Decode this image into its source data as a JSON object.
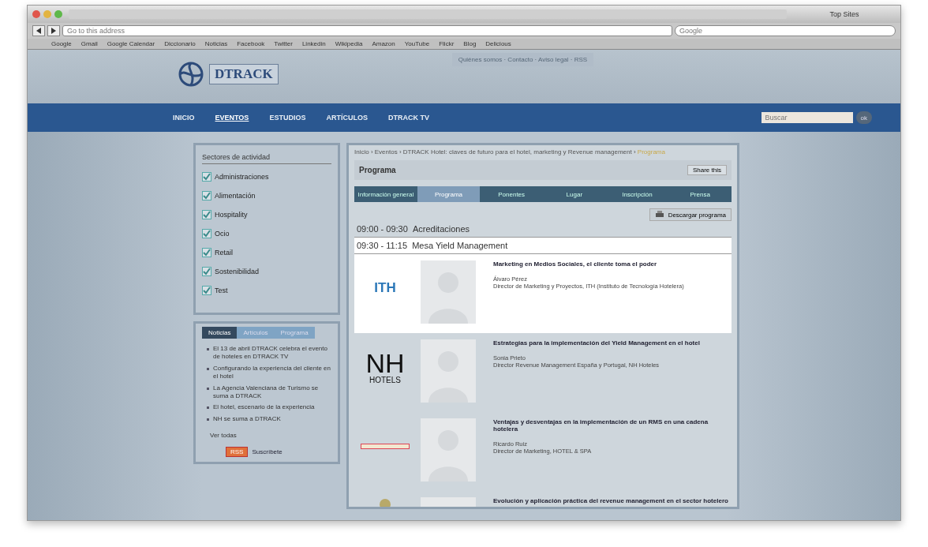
{
  "browser": {
    "tab_title": "Top Sites",
    "address_placeholder": "Go to this address",
    "search_placeholder": "Google",
    "bookmarks": [
      "Google",
      "Gmail",
      "Google Calendar",
      "Diccionario",
      "Noticias",
      "Facebook",
      "Twitter",
      "Linkedin",
      "Wikipedia",
      "Amazon",
      "YouTube",
      "Flickr",
      "Blog",
      "Delicious"
    ]
  },
  "site": {
    "logo": "DTRACK",
    "top_links": "Quiénes somos · Contacto · Aviso legal · RSS",
    "nav": [
      {
        "label": "INICIO",
        "selected": false
      },
      {
        "label": "EVENTOS",
        "selected": true
      },
      {
        "label": "ESTUDIOS",
        "selected": false
      },
      {
        "label": "ARTÍCULOS",
        "selected": false
      },
      {
        "label": "DTRACK TV",
        "selected": false
      }
    ],
    "search_placeholder": "Buscar",
    "search_button": "ok"
  },
  "sidebar": {
    "title": "Sectores de actividad",
    "sectors": [
      {
        "label": "Administraciones",
        "checked": true
      },
      {
        "label": "Alimentación",
        "checked": true
      },
      {
        "label": "Hospitality",
        "checked": true
      },
      {
        "label": "Ocio",
        "checked": true
      },
      {
        "label": "Retail",
        "checked": true
      },
      {
        "label": "Sostenibilidad",
        "checked": true
      },
      {
        "label": "Test",
        "checked": true
      }
    ],
    "tabs": [
      {
        "label": "Noticias",
        "selected": true
      },
      {
        "label": "Artículos",
        "selected": false
      },
      {
        "label": "Programa",
        "selected": false
      }
    ],
    "news": [
      "El 13 de abril DTRACK celebra el evento de hoteles en DTRACK TV",
      "Configurando la experiencia del cliente en el hotel",
      "La Agencia Valenciana de Turismo se suma a DTRACK",
      "El hotel, escenario de la experiencia",
      "NH se suma a DTRACK"
    ],
    "more": "Ver todas",
    "rss": "RSS",
    "subscribe": "Suscríbete"
  },
  "main": {
    "breadcrumb": "Inicio › Eventos › DTRACK Hotel: claves de futuro para el hotel, marketing y Revenue management ›",
    "breadcrumb_current": "Programa",
    "title": "Programa",
    "share": "Share this",
    "tabs": [
      {
        "label": "Información general",
        "selected": false
      },
      {
        "label": "Programa",
        "selected": true
      },
      {
        "label": "Ponentes",
        "selected": false
      },
      {
        "label": "Lugar",
        "selected": false
      },
      {
        "label": "Inscripción",
        "selected": false
      },
      {
        "label": "Prensa",
        "selected": false
      }
    ],
    "download": "Descargar programa",
    "sessions": [
      {
        "time": "09:00 - 09:30",
        "title": "Acreditaciones",
        "highlighted": false
      },
      {
        "time": "09:30 - 11:15",
        "title": "Mesa Yield Management",
        "highlighted": true,
        "talks": [
          {
            "kind": "text",
            "logo": "ITH",
            "talk": "Marketing en Medios Sociales, el cliente toma el poder",
            "speaker": "Álvaro Pérez",
            "role": "Director de Marketing y Proyectos, ITH (Instituto de Tecnología Hotelera)",
            "highlighted": true
          },
          {
            "kind": "stacked",
            "logo": "NH",
            "logo_sub": "HOTELS",
            "talk": "Estrategias para la implementación del Yield Management en el hotel",
            "speaker": "Sonia Prieto",
            "role": "Director Revenue Management España y Portugal, NH Hoteles",
            "highlighted": false
          },
          {
            "kind": "bar",
            "talk": "Ventajas y desventajas en la implementación de un RMS en una cadena hotelera",
            "speaker": "Ricardo Ruiz",
            "role": "Director de Marketing, HOTEL & SPA",
            "highlighted": false
          },
          {
            "kind": "round",
            "talk": "Evolución y aplicación práctica del revenue management en el sector hotelero",
            "highlighted": false
          }
        ]
      }
    ]
  }
}
